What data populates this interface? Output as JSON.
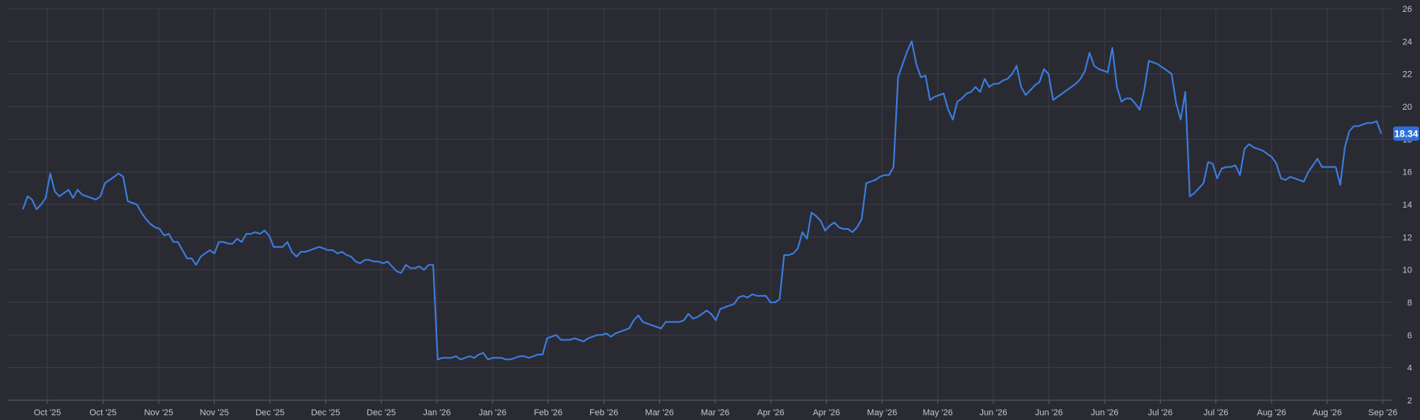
{
  "colors": {
    "background": "#2a2a33",
    "grid": "#3c3c47",
    "axis": "#5a5a66",
    "tick_text": "#c4c4cc",
    "series": "#3b7ee0",
    "badge": "#2f6fd6"
  },
  "chart_data": {
    "type": "line",
    "title": "",
    "xlabel": "",
    "ylabel": "",
    "ylim": [
      2,
      26
    ],
    "y_ticks": [
      2,
      4,
      6,
      8,
      10,
      12,
      14,
      16,
      18,
      20,
      22,
      24,
      26
    ],
    "y_axis_position": "right",
    "grid": true,
    "legend": "none",
    "x_tick_labels": [
      "Oct '25",
      "Oct '25",
      "Nov '25",
      "Nov '25",
      "Dec '25",
      "Dec '25",
      "Dec '25",
      "Jan '26",
      "Jan '26",
      "Feb '26",
      "Feb '26",
      "Mar '26",
      "Mar '26",
      "Apr '26",
      "Apr '26",
      "May '26",
      "May '26",
      "Jun '26",
      "Jun '26",
      "Jun '26",
      "Jul '26",
      "Jul '26",
      "Aug '26",
      "Aug '26",
      "Sep '26"
    ],
    "last_value_label": "18.34",
    "series": [
      {
        "values": [
          13.7,
          14.5,
          14.3,
          13.7,
          14.0,
          14.4,
          15.9,
          14.8,
          14.5,
          14.7,
          14.9,
          14.4,
          14.9,
          14.6,
          14.5,
          14.4,
          14.3,
          14.5,
          15.3,
          15.5,
          15.7,
          15.9,
          15.7,
          14.2,
          14.1,
          14.0,
          13.5,
          13.1,
          12.8,
          12.6,
          12.5,
          12.1,
          12.2,
          11.7,
          11.7,
          11.2,
          10.7,
          10.7,
          10.3,
          10.8,
          11.0,
          11.2,
          11.0,
          11.7,
          11.7,
          11.6,
          11.6,
          11.9,
          11.7,
          12.2,
          12.2,
          12.3,
          12.2,
          12.4,
          12.1,
          11.4,
          11.4,
          11.4,
          11.7,
          11.1,
          10.8,
          11.1,
          11.1,
          11.2,
          11.3,
          11.4,
          11.3,
          11.2,
          11.2,
          11.0,
          11.1,
          10.9,
          10.8,
          10.5,
          10.4,
          10.6,
          10.6,
          10.5,
          10.5,
          10.4,
          10.5,
          10.2,
          9.9,
          9.8,
          10.3,
          10.1,
          10.1,
          10.2,
          10.0,
          10.3,
          10.3,
          4.5,
          4.6,
          4.6,
          4.6,
          4.7,
          4.5,
          4.6,
          4.7,
          4.6,
          4.8,
          4.9,
          4.5,
          4.6,
          4.6,
          4.6,
          4.5,
          4.5,
          4.6,
          4.7,
          4.7,
          4.6,
          4.7,
          4.8,
          4.8,
          5.8,
          5.9,
          6.0,
          5.7,
          5.7,
          5.7,
          5.8,
          5.7,
          5.6,
          5.8,
          5.9,
          6.0,
          6.0,
          6.1,
          5.9,
          6.1,
          6.2,
          6.3,
          6.4,
          6.9,
          7.2,
          6.8,
          6.7,
          6.6,
          6.5,
          6.4,
          6.8,
          6.8,
          6.8,
          6.8,
          6.9,
          7.3,
          7.0,
          7.1,
          7.3,
          7.5,
          7.3,
          6.9,
          7.6,
          7.7,
          7.8,
          7.9,
          8.3,
          8.4,
          8.3,
          8.5,
          8.4,
          8.4,
          8.4,
          8.0,
          8.0,
          8.2,
          10.9,
          10.9,
          11.0,
          11.3,
          12.3,
          11.9,
          13.5,
          13.3,
          13.0,
          12.4,
          12.7,
          12.9,
          12.6,
          12.5,
          12.5,
          12.3,
          12.6,
          13.1,
          15.3,
          15.4,
          15.5,
          15.7,
          15.8,
          15.8,
          16.3,
          21.8,
          22.6,
          23.4,
          24.0,
          22.6,
          21.8,
          21.9,
          20.4,
          20.6,
          20.7,
          20.8,
          19.8,
          19.2,
          20.3,
          20.5,
          20.8,
          20.9,
          21.2,
          20.9,
          21.7,
          21.2,
          21.4,
          21.4,
          21.6,
          21.7,
          22.0,
          22.5,
          21.2,
          20.7,
          21.0,
          21.3,
          21.5,
          22.3,
          22.0,
          20.4,
          20.6,
          20.8,
          21.0,
          21.2,
          21.4,
          21.7,
          22.2,
          23.3,
          22.5,
          22.3,
          22.2,
          22.1,
          23.6,
          21.2,
          20.3,
          20.5,
          20.5,
          20.2,
          19.8,
          21.0,
          22.8,
          22.7,
          22.6,
          22.4,
          22.2,
          22.0,
          20.2,
          19.2,
          20.9,
          14.5,
          14.7,
          15.0,
          15.3,
          16.6,
          16.5,
          15.6,
          16.2,
          16.3,
          16.3,
          16.4,
          15.8,
          17.4,
          17.7,
          17.5,
          17.4,
          17.3,
          17.1,
          16.9,
          16.5,
          15.6,
          15.5,
          15.7,
          15.6,
          15.5,
          15.4,
          16.0,
          16.4,
          16.8,
          16.3,
          16.3,
          16.3,
          16.3,
          15.2,
          17.5,
          18.5,
          18.8,
          18.8,
          18.9,
          19.0,
          19.0,
          19.1,
          18.34
        ]
      }
    ]
  }
}
